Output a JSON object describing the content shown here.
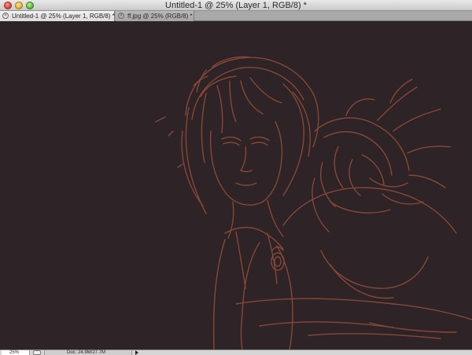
{
  "window": {
    "title": "Untitled-1 @ 25% (Layer 1, RGB/8) *"
  },
  "tabs": [
    {
      "label": "Untitled-1 @ 25% (Layer 1, RGB/8) *",
      "active": true
    },
    {
      "label": "ff.jpg @ 25% (RGB/8) *",
      "active": false
    }
  ],
  "canvas": {
    "background_color": "#2e2326",
    "stroke_color": "#8a4a38"
  },
  "statusbar": {
    "zoom": "25%",
    "doc_info": "Doc: 24.9M/27.7M"
  },
  "icons": {
    "close": "close-window-icon",
    "minimize": "minimize-window-icon",
    "maximize": "zoom-window-icon",
    "tab_close": "tab-close-icon",
    "status_menu": "status-menu-arrow-icon"
  }
}
